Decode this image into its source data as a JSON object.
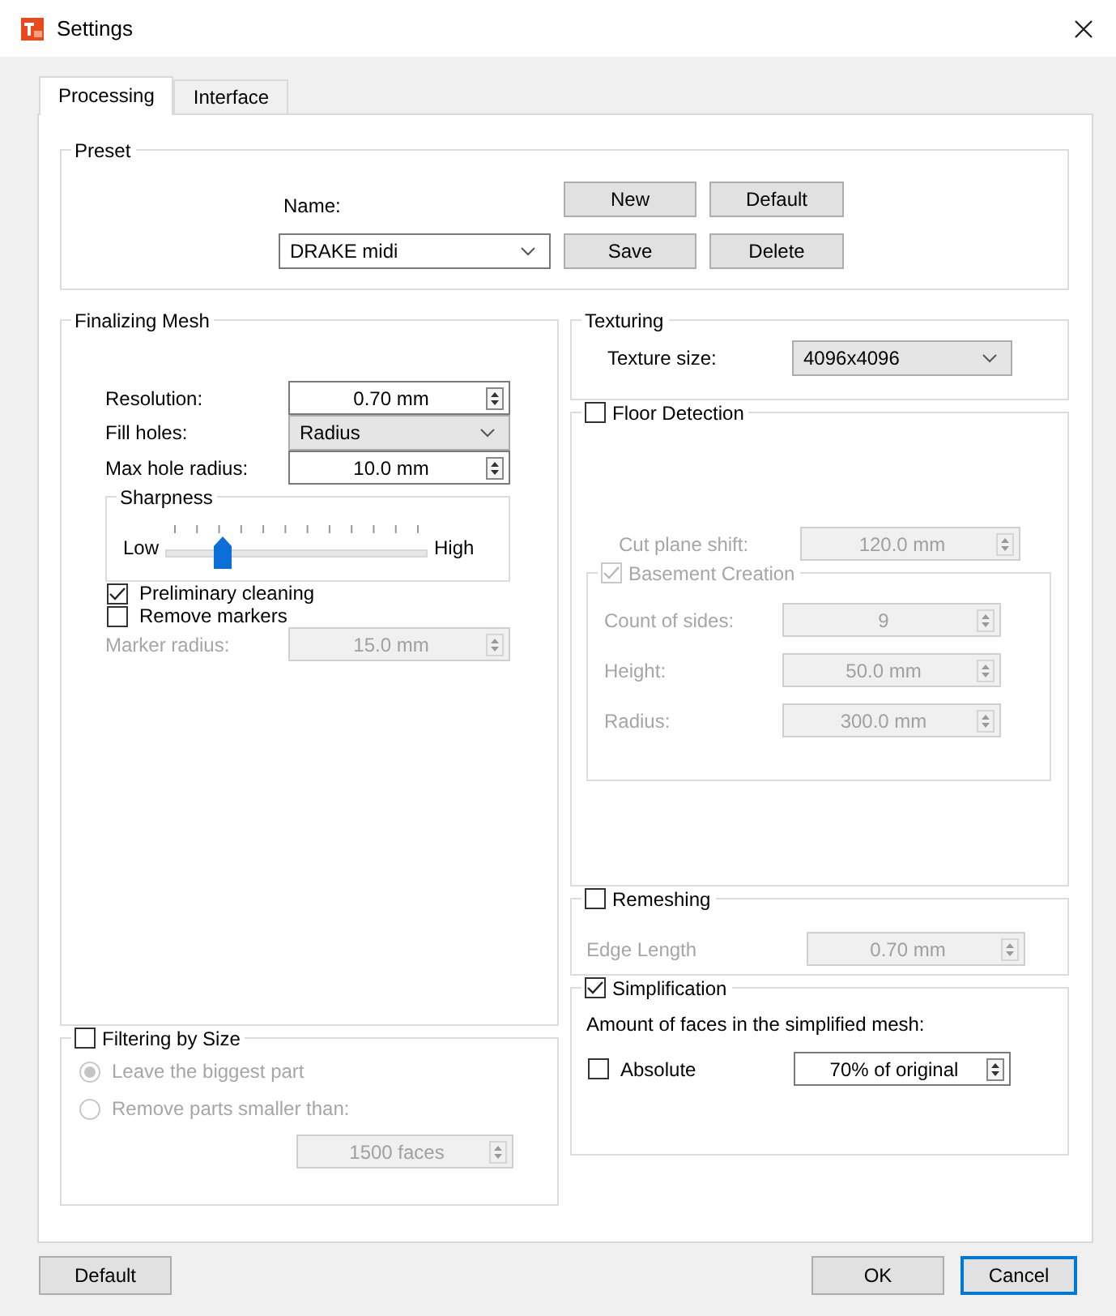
{
  "window": {
    "title": "Settings"
  },
  "tabs": [
    {
      "label": "Processing",
      "selected": true
    },
    {
      "label": "Interface",
      "selected": false
    }
  ],
  "preset": {
    "title": "Preset",
    "name_label": "Name:",
    "name_value": "DRAKE midi",
    "buttons": [
      {
        "label": "New"
      },
      {
        "label": "Default"
      },
      {
        "label": "Save"
      },
      {
        "label": "Delete"
      }
    ]
  },
  "left_groups": [
    {
      "title": "Finalizing Mesh",
      "items": [
        {
          "kind": "spin",
          "label": "Resolution:",
          "value": "0.70 mm",
          "disabled": false
        },
        {
          "kind": "combo",
          "label": "Fill holes:",
          "value": "Radius",
          "disabled": false
        },
        {
          "kind": "spin",
          "label": "Max hole radius:",
          "value": "10.0 mm",
          "disabled": false
        },
        {
          "kind": "slider",
          "title": "Sharpness",
          "low": "Low",
          "high": "High",
          "level": 0.2,
          "disabled": false
        },
        {
          "kind": "check",
          "label": "Preliminary cleaning",
          "checked": true,
          "disabled": false
        },
        {
          "kind": "check",
          "label": "Remove markers",
          "checked": false,
          "disabled": false
        },
        {
          "kind": "spin",
          "label": "Marker radius:",
          "value": "15.0 mm",
          "disabled": true
        }
      ]
    },
    {
      "title": "Filtering by Size",
      "checked": false,
      "items": [
        {
          "kind": "radio",
          "label": "Leave the biggest part",
          "selected": true,
          "disabled": true
        },
        {
          "kind": "radio",
          "label": "Remove parts smaller than:",
          "selected": false,
          "disabled": true
        },
        {
          "kind": "spin",
          "value": "1500 faces",
          "disabled": true
        }
      ]
    }
  ],
  "right_groups": [
    {
      "title": "Texturing",
      "items": [
        {
          "kind": "combo",
          "label": "Texture size:",
          "value": "4096x4096",
          "disabled": false
        }
      ]
    },
    {
      "title": "Floor Detection",
      "checked": false,
      "items": [
        {
          "kind": "spin",
          "label": "Cut plane shift:",
          "value": "120.0 mm",
          "disabled": true
        },
        {
          "kind": "group",
          "title": "Basement Creation",
          "checked": true,
          "disabled": true,
          "items": [
            {
              "kind": "spin",
              "label": "Count of sides:",
              "value": "9",
              "disabled": true
            },
            {
              "kind": "spin",
              "label": "Height:",
              "value": "50.0 mm",
              "disabled": true
            },
            {
              "kind": "spin",
              "label": "Radius:",
              "value": "300.0 mm",
              "disabled": true
            }
          ]
        }
      ]
    },
    {
      "title": "Remeshing",
      "checked": false,
      "items": [
        {
          "kind": "spin",
          "label": "Edge Length",
          "value": "0.70 mm",
          "disabled": true
        }
      ]
    },
    {
      "title": "Simplification",
      "checked": true,
      "items": [
        {
          "kind": "text",
          "label": "Amount of faces in the simplified mesh:"
        },
        {
          "kind": "check_spin",
          "label": "Absolute",
          "checked": false,
          "value": "70% of original",
          "disabled": false
        }
      ]
    }
  ],
  "footer_buttons": [
    {
      "label": "Default",
      "focused": false
    },
    {
      "label": "OK",
      "focused": false
    },
    {
      "label": "Cancel",
      "focused": true
    }
  ]
}
